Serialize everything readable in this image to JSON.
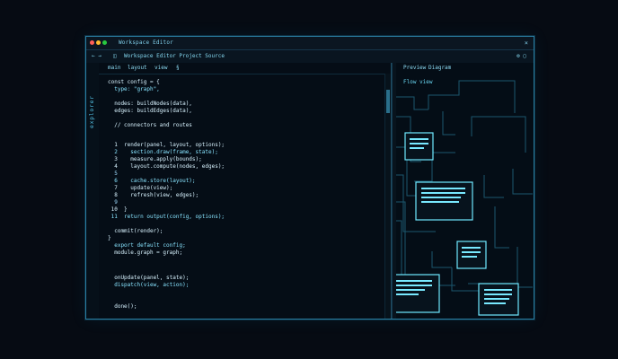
{
  "app": {
    "title": "Workspace Editor"
  },
  "toolbar": {
    "nav_back": "←  →",
    "path": "Workspace Editor Project Source",
    "layout_btn": "◫",
    "right_icons": "⚙  ▢"
  },
  "editor": {
    "tabs": [
      "main",
      "layout",
      "view",
      "§"
    ],
    "side_label": "explorer",
    "lines": [
      "const config = {",
      "  type: \"graph\",",
      "",
      "  nodes: buildNodes(data),",
      "  edges: buildEdges(data),",
      "",
      "  // connectors and routes",
      "",
      "  1  render(panel, layout, options);",
      "  2    section.draw(frame, state);",
      "  3    measure.apply(bounds);",
      "  4    layout.compute(nodes, edges);",
      "  5",
      "  6    cache.store(layout);",
      "  7    update(view);",
      "  8    refresh(view, edges);",
      "  9",
      " 10  }",
      " 11  return output(config, options);",
      "",
      "  commit(render);",
      "}",
      "  export default config;",
      "  module.graph = graph;",
      "",
      "  onUpdate(panel, state);",
      "  dispatch(view, action);",
      "",
      "  done();"
    ]
  },
  "panel": {
    "tabs": [
      "Preview",
      "Diagram"
    ],
    "subtitle": "Flow view"
  },
  "colors": {
    "accent": "#6fe8ff",
    "window_border": "#2a7fa3",
    "background": "#060b13"
  }
}
